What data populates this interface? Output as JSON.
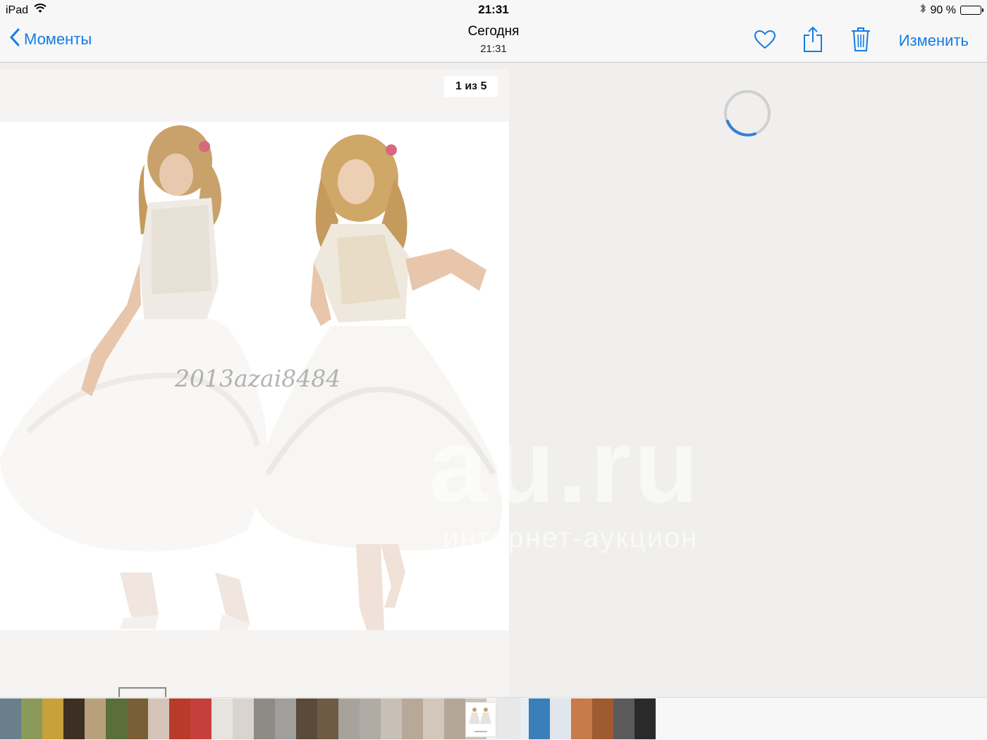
{
  "status_bar": {
    "device": "iPad",
    "time": "21:31",
    "battery": "90 %",
    "battery_level": 0.9
  },
  "nav": {
    "back_label": "Моменты",
    "title": "Сегодня",
    "subtitle": "21:31",
    "edit_label": "Изменить",
    "icons": [
      "heart-icon",
      "share-icon",
      "trash-icon"
    ],
    "accent_color": "#137ce6"
  },
  "viewer": {
    "counter": "1 из 5",
    "photo_watermark": "2013azai8484",
    "site_watermark": "au.ru",
    "site_watermark_sub": "интернет-аукцион",
    "loading": true
  },
  "filmstrip": {
    "thumb_colors": [
      "#6a7f8c",
      "#8b9a5a",
      "#c7a23a",
      "#3d2f22",
      "#b9a07c",
      "#5a6f3c",
      "#7a5e36",
      "#d4c5b8",
      "#b93a2a",
      "#c4403a",
      "#e7e3de",
      "#d9d4cf",
      "#8e8a86",
      "#a09f9c",
      "#5a4a3a",
      "#6f5a44",
      "#a8a29c",
      "#b1aba5",
      "#c8bfb6",
      "#b8a898",
      "#d2c7bc",
      "#b4a79a",
      "#c9c2bb",
      "#f2f2f2",
      "#e8eef4",
      "#3a7fb8",
      "#e0e6ec",
      "#c87a48",
      "#a05a30",
      "#5a5a5a",
      "#2a2a2a"
    ]
  }
}
